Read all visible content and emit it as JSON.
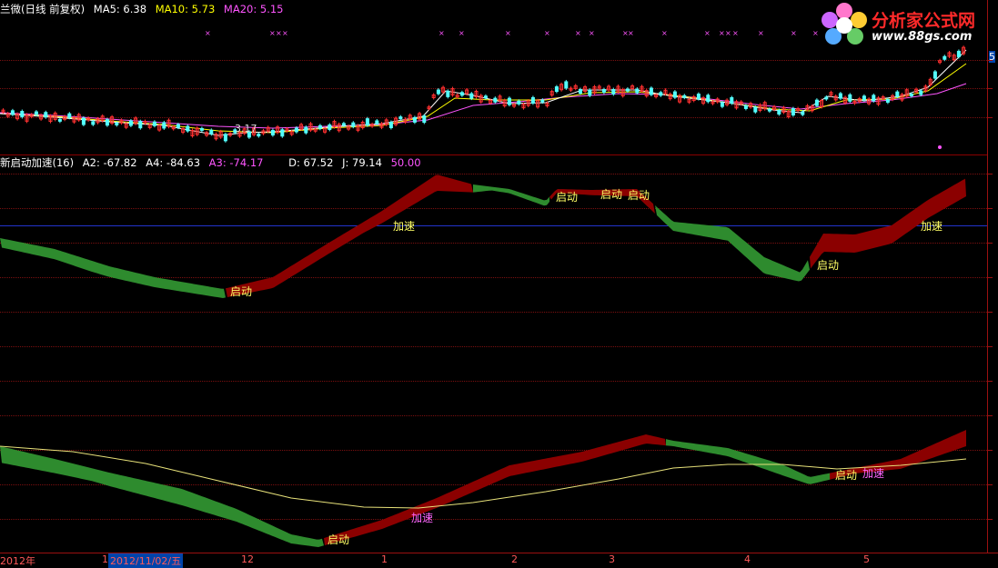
{
  "header": {
    "stock_label": "兰微(日线 前复权)",
    "ma5": "MA5: 6.38",
    "ma10": "MA10: 5.73",
    "ma20": "MA20: 5.15"
  },
  "price_panel": {
    "low_label": "3.17",
    "right_scale_label": "5"
  },
  "indicator_panel": {
    "name": "新启动加速(16)",
    "a2": "A2: -67.82",
    "a4": "A4: -84.63",
    "a3": "A3: -74.17",
    "d": "D: 67.52",
    "j": "J: 79.14",
    "val": "50.00"
  },
  "signals": {
    "start": "启动",
    "accel": "加速"
  },
  "time_axis": {
    "year": "2012年",
    "m11": "1",
    "cursor_date": "2012/11/02/五",
    "m12": "12",
    "m1": "1",
    "m2": "2",
    "m3": "3",
    "m4": "4",
    "m5": "5"
  },
  "logo": {
    "title": "分析家公式网",
    "url": "www.88gs.com"
  },
  "colors": {
    "up": "#ff3030",
    "down": "#54ffff",
    "ma5": "#ffffff",
    "ma10": "#ffff00",
    "ma20": "#ff55ff",
    "band_rise": "#8b0000",
    "band_fall": "#2e8b2e",
    "grid": "#7a1010"
  }
}
